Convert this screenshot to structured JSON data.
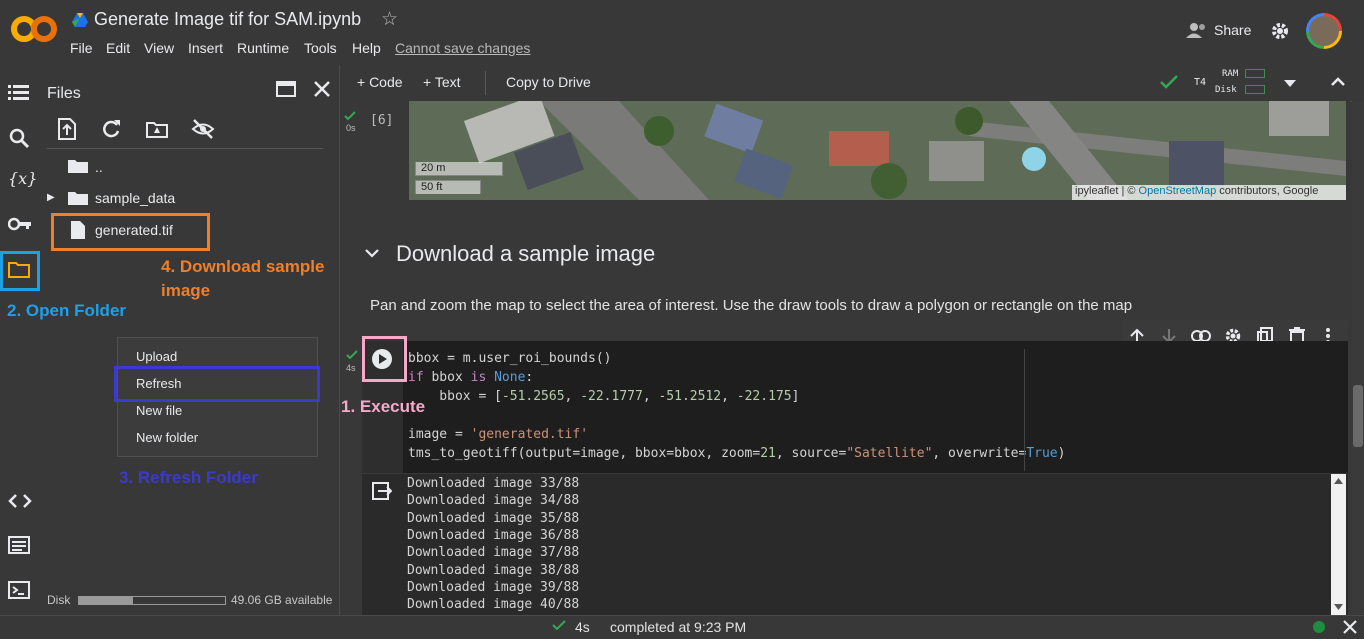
{
  "header": {
    "title": "Generate Image tif for SAM.ipynb",
    "menus": [
      "File",
      "Edit",
      "View",
      "Insert",
      "Runtime",
      "Tools",
      "Help"
    ],
    "cannot_save": "Cannot save changes",
    "share_label": "Share",
    "logo_text": "CO"
  },
  "files_panel": {
    "title": "Files",
    "items": [
      "..",
      "sample_data",
      "generated.tif"
    ],
    "context_menu": [
      "Upload",
      "Refresh",
      "New file",
      "New folder"
    ],
    "disk_label": "Disk",
    "disk_free": "49.06 GB available",
    "disk_used_fraction": 0.37
  },
  "annotations": {
    "step1": "1. Execute",
    "step2": "2. Open Folder",
    "step3": "3. Refresh Folder",
    "step4_line1": "4. Download sample",
    "step4_line2": "image",
    "colors": {
      "execute": "#f4a9c8",
      "folder": "#1ea0e6",
      "refresh": "#3a3ad0",
      "download": "#f07f2a"
    }
  },
  "toolbar": {
    "code_label": "+ Code",
    "text_label": "+ Text",
    "copy_label": "Copy to Drive",
    "runtime": "T4",
    "ram_label": "RAM",
    "disk_label": "Disk"
  },
  "prev_cell": {
    "exec_count": "[6]",
    "duration": "0s",
    "map_scale_m": "20 m",
    "map_scale_ft": "50 ft",
    "attribution_prefix": "ipyleaflet | © ",
    "attribution_link": "OpenStreetMap",
    "attribution_suffix": " contributors, Google"
  },
  "section": {
    "heading": "Download a sample image",
    "description": "Pan and zoom the map to select the area of interest. Use the draw tools to draw a polygon or rectangle on the map"
  },
  "code_cell": {
    "duration": "4s",
    "lines": {
      "l1": "bbox = m.user_roi_bounds()",
      "l2a": "if",
      "l2b": " bbox ",
      "l2c": "is",
      "l2d": " ",
      "l2e": "None",
      "l2f": ":",
      "l3a": "    bbox = [",
      "l3b": "-51.2565",
      "l3c": ", ",
      "l3d": "-22.1777",
      "l3e": ", ",
      "l3f": "-51.2512",
      "l3g": ", ",
      "l3h": "-22.175",
      "l3i": "]",
      "l5a": "image = ",
      "l5b": "'generated.tif'",
      "l6a": "tms_to_geotiff(output=image, bbox=bbox, zoom=",
      "l6b": "21",
      "l6c": ", source=",
      "l6d": "\"Satellite\"",
      "l6e": ", overwrite=",
      "l6f": "True",
      "l6g": ")"
    }
  },
  "output": {
    "lines": [
      "Downloaded image 33/88",
      "Downloaded image 34/88",
      "Downloaded image 35/88",
      "Downloaded image 36/88",
      "Downloaded image 37/88",
      "Downloaded image 38/88",
      "Downloaded image 39/88",
      "Downloaded image 40/88"
    ]
  },
  "status": {
    "duration": "4s",
    "completed": "completed at 9:23 PM"
  }
}
